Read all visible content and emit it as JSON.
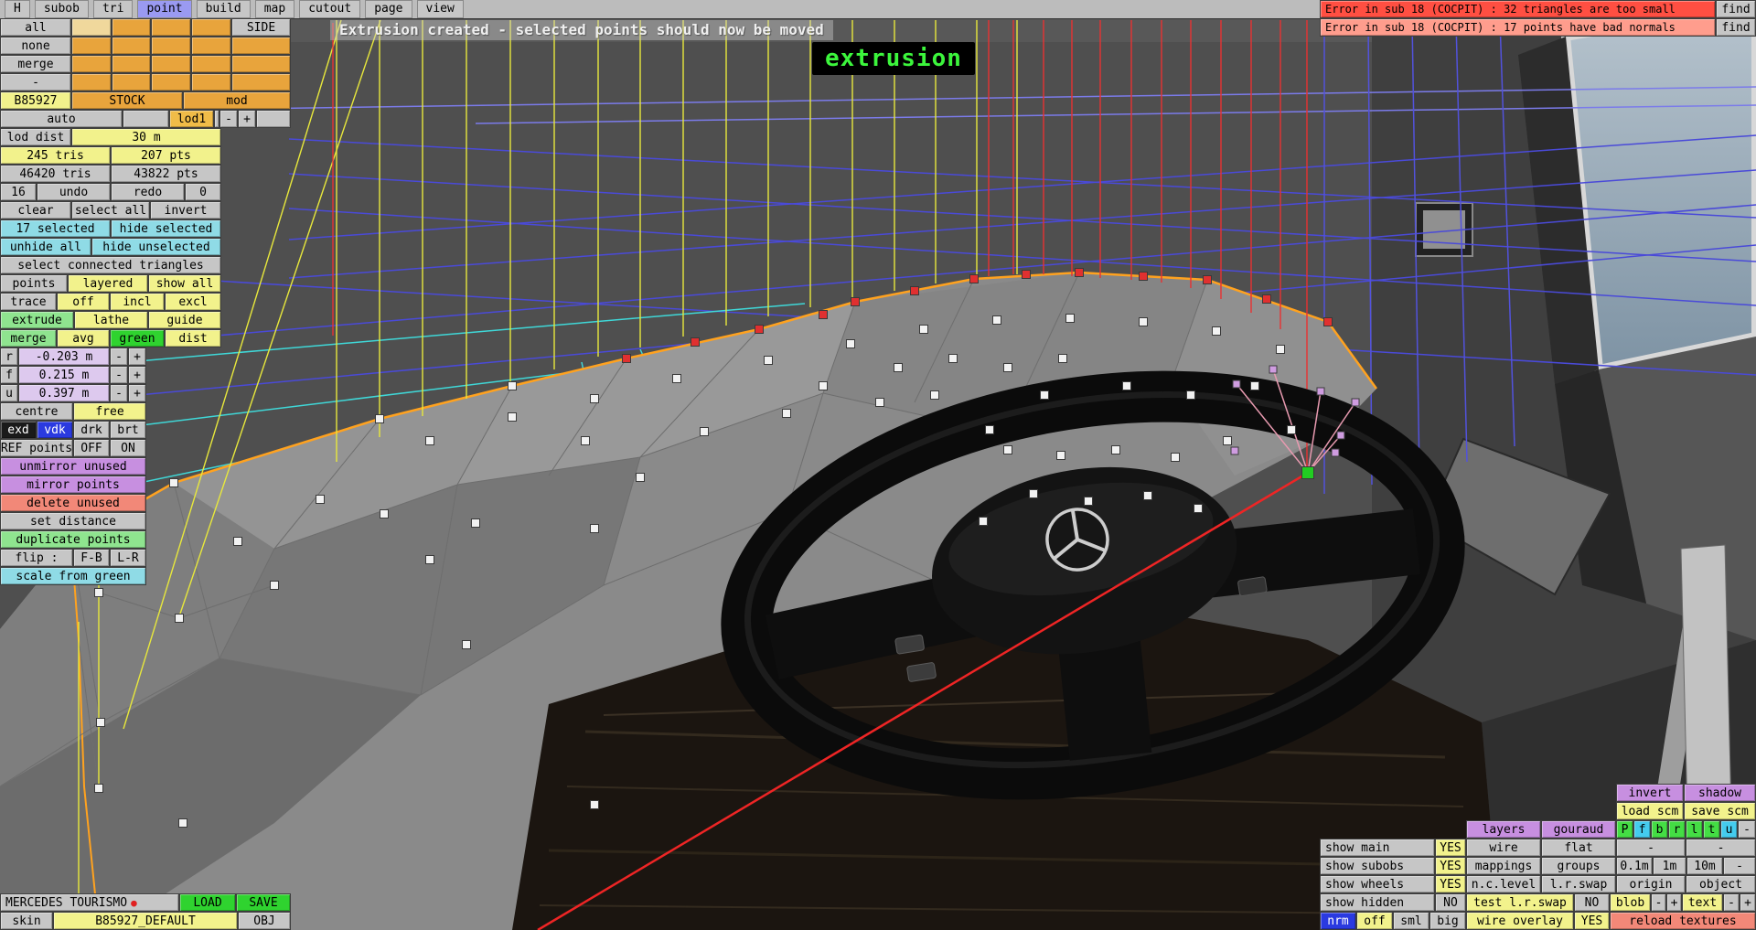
{
  "menu": {
    "items": [
      "H",
      "subob",
      "tri",
      "point",
      "build",
      "map",
      "cutout",
      "page",
      "view"
    ]
  },
  "errors": {
    "e1": {
      "text": "Error in sub 18 (COCPIT) : 32 triangles are too small",
      "find": "find"
    },
    "e2": {
      "text": "Error in sub 18 (COCPIT) : 17 points have bad normals",
      "find": "find"
    }
  },
  "status_message": "Extrusion created - selected points should now be moved",
  "mode_label": "extrusion",
  "material_panel": {
    "all": "all",
    "none": "none",
    "merge": "merge",
    "dash": "-",
    "side": "SIDE",
    "id": "B85927",
    "stock": "STOCK",
    "mod": "mod",
    "auto": "auto",
    "lod1": "lod1",
    "minus": "-",
    "plus": "+"
  },
  "left_panel": {
    "lod_dist_label": "lod dist",
    "lod_dist_value": "30 m",
    "tris": "245 tris",
    "pts": "207 pts",
    "tris_total": "46420 tris",
    "pts_total": "43822 pts",
    "undo_count": "16",
    "undo": "undo",
    "redo": "redo",
    "redo_count": "0",
    "clear": "clear",
    "select_all": "select all",
    "invert": "invert",
    "selected_count": "17 selected",
    "hide_selected": "hide selected",
    "unhide_all": "unhide all",
    "hide_unselected": "hide unselected",
    "select_connected": "select connected triangles",
    "points": "points",
    "layered": "layered",
    "show_all": "show all",
    "trace": "trace",
    "off": "off",
    "incl": "incl",
    "excl": "excl",
    "extrude": "extrude",
    "lathe": "lathe",
    "guide": "guide",
    "merge": "merge",
    "avg": "avg",
    "green": "green",
    "dist": "dist",
    "r_label": "r",
    "r_value": "-0.203 m",
    "f_label": "f",
    "f_value": "0.215 m",
    "u_label": "u",
    "u_value": "0.397 m",
    "minus": "-",
    "plus": "+",
    "centre": "centre",
    "free": "free",
    "exd": "exd",
    "vdk": "vdk",
    "drk": "drk",
    "brt": "brt",
    "ref_points": "REF points",
    "ref_off": "OFF",
    "ref_on": "ON",
    "unmirror": "unmirror unused",
    "mirror": "mirror points",
    "delete_unused": "delete unused",
    "set_distance": "set distance",
    "duplicate": "duplicate points",
    "flip": "flip :",
    "fb": "F-B",
    "lr": "L-R",
    "scale_green": "scale from green"
  },
  "bottom_left": {
    "model_name": "MERCEDES TOURISMO",
    "unsaved": "●",
    "load": "LOAD",
    "save": "SAVE",
    "skin": "skin",
    "skin_value": "B85927_DEFAULT",
    "obj": "OBJ"
  },
  "display_panel": {
    "invert": "invert",
    "shadow": "shadow",
    "load_scm": "load scm",
    "save_scm": "save scm",
    "layers": "layers",
    "gouraud": "gouraud",
    "channels": [
      "P",
      "f",
      "b",
      "r",
      "l",
      "t",
      "u",
      "-"
    ],
    "show_main": "show main",
    "show_main_v": "YES",
    "wire": "wire",
    "flat": "flat",
    "dash1": "-",
    "dash2": "-",
    "show_subobs": "show subobs",
    "show_subobs_v": "YES",
    "mappings": "mappings",
    "groups": "groups",
    "m01": "0.1m",
    "m1": "1m",
    "m10": "10m",
    "mdash": "-",
    "show_wheels": "show wheels",
    "show_wheels_v": "YES",
    "nclevel": "n.c.level",
    "lrswap": "l.r.swap",
    "origin": "origin",
    "object": "object",
    "show_hidden": "show hidden",
    "show_hidden_v": "NO",
    "test_lrswap": "test l.r.swap",
    "test_lrswap_v": "NO",
    "blob": "blob",
    "bminus": "-",
    "bplus": "+",
    "text": "text",
    "tminus": "-",
    "tplus": "+",
    "nrm": "nrm",
    "off": "off",
    "sml": "sml",
    "big": "big",
    "wire_overlay": "wire overlay",
    "wire_overlay_v": "YES",
    "reload_textures": "reload textures"
  },
  "viewport": {
    "colors": {
      "bg": "#4f4f4f",
      "wire_yellow": "#e8e83c",
      "wire_red": "#e83232",
      "grid_blue": "#4a4ad8",
      "grid_purple": "#7b7bea",
      "grid_cyan": "#3fd8d8",
      "edge_orange": "#ffa21f",
      "point_white": "#f2f2f2",
      "point_red": "#e03030",
      "point_green": "#22cc22",
      "point_violet": "#cf9ce0",
      "mesh_wire": "#6e6e6e",
      "axis_red": "#ee2525",
      "sky_top": "#b7c4ce",
      "sky_bottom": "#7e93a4"
    }
  }
}
